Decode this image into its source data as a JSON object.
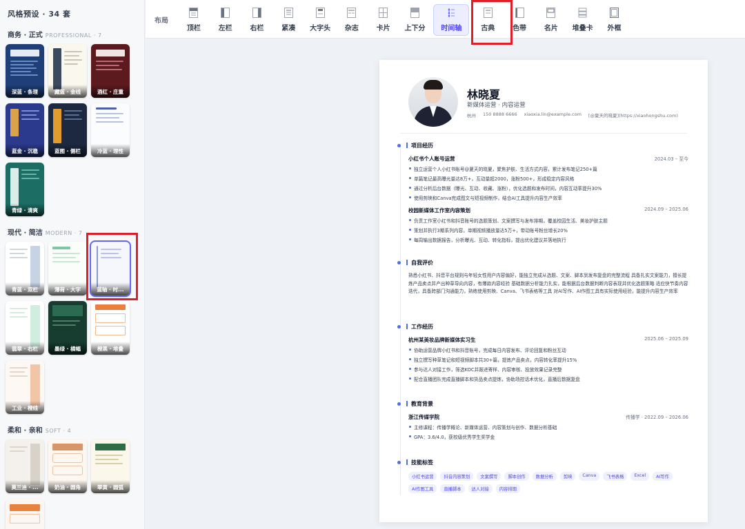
{
  "sidebar": {
    "title": "风格预设 · 34 套",
    "sections": [
      {
        "name": "商务 · 正式",
        "sub": "PROFESSIONAL · 7",
        "cards": [
          "深蓝 · 条理",
          "藏蓝 · 金线",
          "酒红 · 庄重",
          "蓝金 · 沉稳",
          "蓝图 · 侧栏",
          "冷蓝 · 理性",
          "青绿 · 清爽"
        ]
      },
      {
        "name": "现代 · 简洁",
        "sub": "MODERN · 7",
        "cards": [
          "青蓝 · 双栏",
          "薄荷 · 大字",
          "蓝轴 · 时...",
          "翡翠 · 右栏",
          "墨绿 · 横幅",
          "橙黑 · 堆叠",
          "工业 · 橙线"
        ]
      },
      {
        "name": "柔和 · 亲和",
        "sub": "SOFT · 4",
        "cards": [
          "莫兰迪 · ...",
          "奶油 · 圆角",
          "翠黄 · 圆弧",
          ""
        ]
      }
    ]
  },
  "topbar": {
    "label": "布局",
    "tabs": [
      "顶栏",
      "左栏",
      "右栏",
      "紧凑",
      "大字头",
      "杂志",
      "卡片",
      "上下分",
      "时间轴",
      "古典",
      "色带",
      "名片",
      "堆叠卡",
      "外框"
    ],
    "active_tab": "时间轴"
  },
  "resume": {
    "name": "林晓夏",
    "role": "新媒体运营 · 内容运营",
    "contact": [
      "杭州",
      "150 8888 6666",
      "xiaoxia.lin@example.com",
      "[@夏天的晓夏](https://xiaohongshu.com)"
    ],
    "projects": {
      "title": "项目经历",
      "items": [
        {
          "name": "小红书个人账号运营",
          "date": "2024.03 – 至今",
          "bullets": [
            "独立运营个人小红书账号@夏天的晓夏，聚焦护肤、生活方式内容，累计发布笔记250+篇",
            "单篇笔记最高曝光量达8万+，互动量超2000，涨粉500+，形成稳定内容风格",
            "通过分析后台数据（曝光、互动、收藏、涨粉），优化选题和发布时间，内容互动率提升30%",
            "使用剪映和Canva完成图文与短视频制作，结合AI工具提升内容生产效率"
          ]
        },
        {
          "name": "校园新媒体工作室内容策划",
          "date": "2024.09 – 2025.06",
          "bullets": [
            "负责工作室小红书和抖音账号的选题策划、文案撰写与发布排期，覆盖校园生活、美妆护肤主题",
            "策划并执行3期系列内容，单期视频播放量达5万+，带动账号粉丝增长20%",
            "每周输出数据报告，分析曝光、互动、转化指标，提出优化建议并落地执行"
          ]
        }
      ]
    },
    "summary": {
      "title": "自我评价",
      "text": "熟悉小红书、抖音平台规则与年轻女性用户内容偏好，能独立完成从选题、文案、脚本到发布复盘的完整流程 具备扎实文案能力，擅长提炼产品卖点并产出种草导向内容，有爆款内容经验 基础数据分析能力扎实，能根据后台数据判断内容表现并优化选题策略 适应快节奏内容迭代，具备跨部门沟通能力，熟练使用剪映、Canva、飞书表格等工具 对AI写作、AI作图工具有实际使用经验，能提升内容生产效率"
    },
    "work": {
      "title": "工作经历",
      "items": [
        {
          "name": "杭州某美妆品牌新媒体实习生",
          "date": "2025.06 – 2025.09",
          "bullets": [
            "协助运营品牌小红书和抖音账号，完成每日内容发布、评论回复和粉丝互动",
            "独立撰写种草笔记和短视频脚本共30+篇，提炼产品卖点，内容转化率提升15%",
            "参与达人对接工作，筛选KOC并跟进寄样、内容审核、投放效果记录完整",
            "配合直播团队完成直播脚本和货品卖点提炼，协助场控话术优化，直播后数据复盘"
          ]
        }
      ]
    },
    "education": {
      "title": "教育背景",
      "items": [
        {
          "name": "浙江传媒学院",
          "date": "传播学 · 2022.09 – 2026.06",
          "bullets": [
            "主修课程：传播学概论、新媒体运营、内容策划与创作、数据分析基础",
            "GPA：3.6/4.0，获校级优秀学生奖学金"
          ]
        }
      ]
    },
    "skills": {
      "title": "技能标签",
      "tags": [
        "小红书运营",
        "抖音内容策划",
        "文案撰写",
        "脚本创作",
        "数据分析",
        "剪映",
        "Canva",
        "飞书表格",
        "Excel",
        "AI写作",
        "AI作图工具",
        "直播脚本",
        "达人对接",
        "内容排期"
      ]
    }
  },
  "colors": {
    "accent": "#4f46e5",
    "highlight": "#e11d2a",
    "timeline_dot": "#4f6fd9"
  }
}
